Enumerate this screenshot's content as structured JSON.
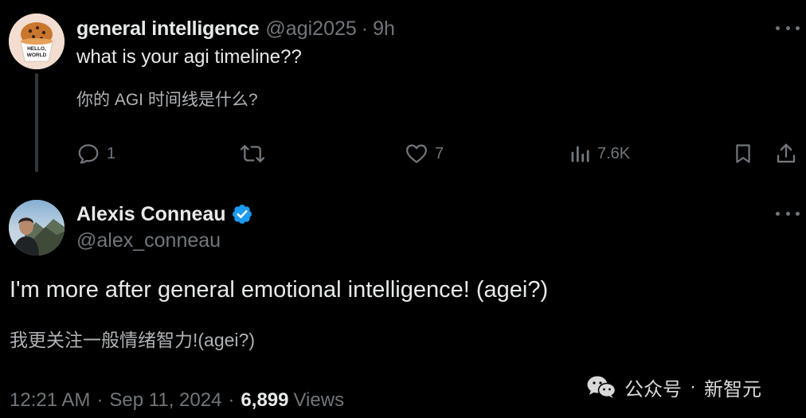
{
  "reply_to": {
    "author_name": "general intelligence",
    "handle": "@agi2025",
    "separator": "·",
    "time": "9h",
    "text": "what is your agi timeline??",
    "translation": "你的 AGI 时间线是什么?",
    "avatar_text": "HELLO, WORLD",
    "stats": {
      "replies": "1",
      "likes": "7",
      "views": "7.6K"
    }
  },
  "tweet": {
    "author_name": "Alexis Conneau",
    "handle": "@alex_conneau",
    "text": "I'm more after general emotional intelligence! (agei?)",
    "translation": "我更关注一般情绪智力!(agei?)",
    "time": "12:21 AM",
    "date": "Sep 11, 2024",
    "separator": "·",
    "views_count": "6,899",
    "views_label": "Views"
  },
  "watermark": {
    "left": "公众号",
    "separator": "·",
    "right": "新智元"
  },
  "colors": {
    "background": "#000000",
    "primary_text": "#e7e9ea",
    "secondary_text": "#71767b",
    "verified_blue": "#1d9bf0",
    "thread_line": "#333639"
  }
}
